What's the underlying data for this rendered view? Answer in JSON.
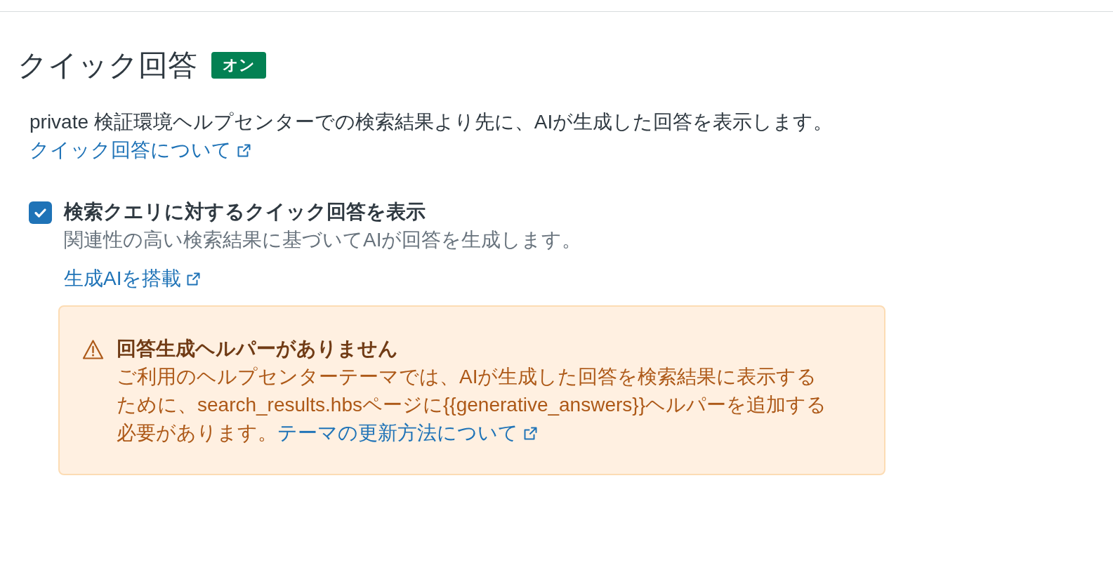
{
  "header": {
    "title": "クイック回答",
    "status_badge": "オン"
  },
  "description": "private 検証環境ヘルプセンターでの検索結果より先に、AIが生成した回答を表示します。",
  "about_link": {
    "label": "クイック回答について",
    "external": true
  },
  "setting": {
    "label": "検索クエリに対するクイック回答を表示",
    "checked": true,
    "hint": "関連性の高い検索結果に基づいてAIが回答を生成します。",
    "link": {
      "label": "生成AIを搭載",
      "external": true
    }
  },
  "alert": {
    "title": "回答生成ヘルパーがありません",
    "body": "ご利用のヘルプセンターテーマでは、AIが生成した回答を検索結果に表示するために、search_results.hbsページに{{generative_answers}}ヘルパーを追加する必要があります。",
    "link": {
      "label": "テーマの更新方法について",
      "external": true
    }
  }
}
